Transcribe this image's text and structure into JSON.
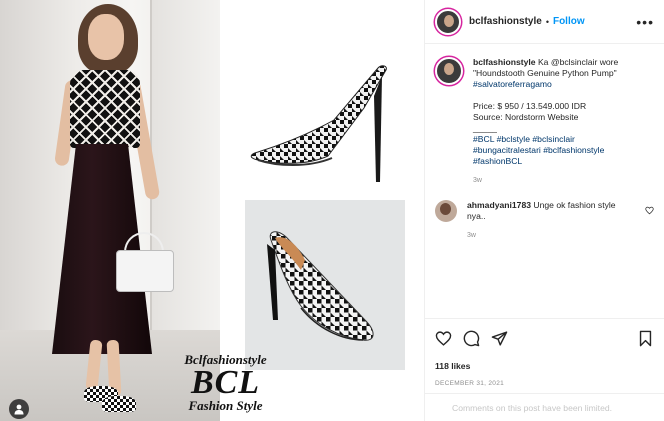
{
  "post": {
    "username": "bclfashionstyle",
    "separator": "•",
    "follow_label": "Follow",
    "more_label": "•••"
  },
  "watermark": {
    "line1": "Bclfashionstyle",
    "line2": "BCL",
    "line3": "Fashion Style"
  },
  "caption": {
    "username": "bclfashionstyle",
    "line1": "Ka @bclsinclair wore",
    "line2": "\"Houndstooth Genuine Python Pump\"",
    "line3": "#salvatoreferragamo",
    "price": "Price: $ 950 / 13.549.000 IDR",
    "source": "Source: Nordstorm Website",
    "rule": "_____",
    "tags1": "#BCL #bclstyle #bclsinclair",
    "tags2": "#bungacitralestari #bclfashionstyle",
    "tags3": "#fashionBCL",
    "time": "3w"
  },
  "comment": {
    "username": "ahmadyani1783",
    "text": "Unge ok fashion style nya..",
    "time": "3w"
  },
  "actions": {
    "likes": "118 likes",
    "date": "DECEMBER 31, 2021",
    "limited": "Comments on this post have been limited."
  },
  "icons": [
    "tag-user-icon",
    "heart-icon",
    "comment-icon",
    "share-icon",
    "save-icon",
    "more-options-icon"
  ],
  "colors": {
    "link": "#0095f6",
    "hashtag": "#00376b",
    "muted": "#8e8e8e",
    "text": "#262626"
  }
}
